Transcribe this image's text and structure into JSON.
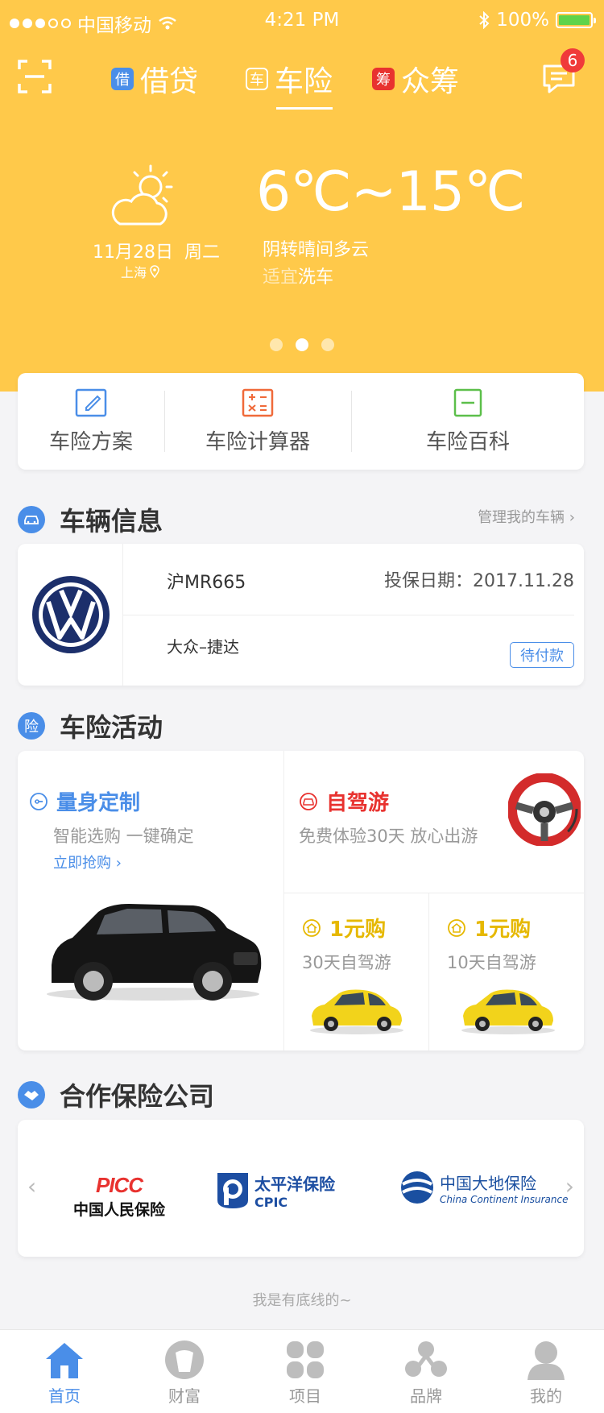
{
  "status_bar": {
    "carrier": "中国移动",
    "time": "4:21 PM",
    "battery": "100%"
  },
  "header": {
    "tabs": [
      {
        "tag": "借",
        "label": "借贷",
        "tag_color": "#4a8ee8"
      },
      {
        "tag": "车",
        "label": "车险",
        "tag_color": "#ffc94a"
      },
      {
        "tag": "筹",
        "label": "众筹",
        "tag_color": "#e8322f"
      }
    ],
    "active_tab": "车险",
    "message_count": "6"
  },
  "weather": {
    "date": "11月28日",
    "weekday": "周二",
    "city": "上海",
    "temp": "6℃~15℃",
    "condition": "阴转晴间多云",
    "advice_prefix": "适宜",
    "advice": "洗车"
  },
  "quick_actions": [
    {
      "label": "车险方案",
      "icon": "edit-icon",
      "color": "#4a8ee8"
    },
    {
      "label": "车险计算器",
      "icon": "calculator-icon",
      "color": "#f06a3a"
    },
    {
      "label": "车险百科",
      "icon": "book-icon",
      "color": "#5cbf4a"
    }
  ],
  "vehicle_section": {
    "title": "车辆信息",
    "manage_link": "管理我的车辆",
    "plate": "沪MR665",
    "insure_date_label": "投保日期：",
    "insure_date": "2017.11.28",
    "model": "大众–捷达",
    "status": "待付款"
  },
  "activity_section": {
    "title": "车险活动",
    "icon_text": "险",
    "custom": {
      "title": "量身定制",
      "subtitle": "智能选购 一键确定",
      "cta": "立即抢购"
    },
    "roadtrip": {
      "title": "自驾游",
      "subtitle": "免费体验30天 放心出游"
    },
    "deals": [
      {
        "title": "1元购",
        "subtitle": "30天自驾游"
      },
      {
        "title": "1元购",
        "subtitle": "10天自驾游"
      }
    ]
  },
  "partners_section": {
    "title": "合作保险公司",
    "partners": [
      {
        "logo_text": "PICC",
        "name": "中国人民保险"
      },
      {
        "name": "太平洋保险",
        "en": "CPIC"
      },
      {
        "name": "中国大地保险",
        "en": "China Continent Insurance"
      }
    ]
  },
  "footer_note": "我是有底线的~",
  "bottom_nav": [
    {
      "label": "首页",
      "active": true
    },
    {
      "label": "财富"
    },
    {
      "label": "项目"
    },
    {
      "label": "品牌"
    },
    {
      "label": "我的"
    }
  ],
  "colors": {
    "brand_yellow": "#ffc94a",
    "accent_blue": "#4a8ee8",
    "alert_red": "#e8322f",
    "deal_yellow": "#e6b800"
  }
}
